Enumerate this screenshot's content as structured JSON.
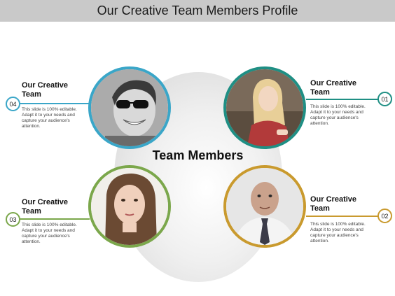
{
  "title": "Our Creative Team Members Profile",
  "center_label": "Team Members",
  "members": [
    {
      "number": "04",
      "title_line1": "Our Creative",
      "title_line2": "Team",
      "text": [
        "This slide is 100% editable.",
        "Adapt it to your needs and",
        "capture your audience's",
        "attention."
      ],
      "color": "#3aa6c8"
    },
    {
      "number": "01",
      "title_line1": "Our Creative",
      "title_line2": "Team",
      "text": [
        "This slide is 100% editable.",
        "Adapt it to your needs and",
        "capture your audience's",
        "attention."
      ],
      "color": "#1f8f84"
    },
    {
      "number": "03",
      "title_line1": "Our Creative",
      "title_line2": "Team",
      "text": [
        "This slide is 100% editable.",
        "Adapt it to your needs and",
        "capture your audience's",
        "attention."
      ],
      "color": "#7ba74b"
    },
    {
      "number": "02",
      "title_line1": "Our Creative",
      "title_line2": "Team",
      "text": [
        "This slide is 100% editable.",
        "Adapt it to your needs and",
        "capture your audience's",
        "attention."
      ],
      "color": "#c99a2e"
    }
  ]
}
